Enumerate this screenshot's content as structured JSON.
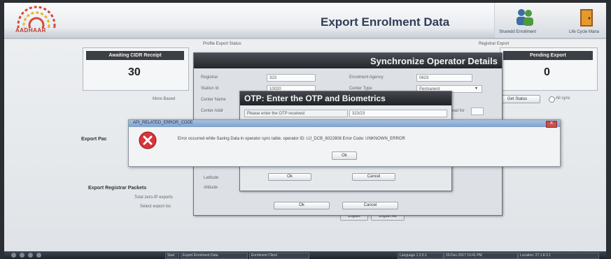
{
  "header": {
    "logo_text": "AADHAAR",
    "title": "Export Enrolment Data",
    "link_left": "Sharedd Enrollment",
    "link_right": "Life Cycle Mana"
  },
  "left_panel": {
    "legend": "Profile Export Status",
    "label": "Awaiting CIDR Receipt",
    "value": "30",
    "more_label": "More Based",
    "export_label": "Export Pac",
    "registrar_label": "Export Registrar Packets",
    "total_label": "Total zero-IP exports",
    "select_label": "Select export loc"
  },
  "right_panel": {
    "legend": "Registrar Export",
    "label": "Pending Export",
    "value": "0",
    "status_button": "Get Status",
    "all_sync_label": "All sync",
    "export_button": "Export",
    "export_all_button": "Export All"
  },
  "sync_dialog": {
    "title": "Synchronize Operator Details",
    "registrar_label": "Registrar",
    "registrar_value": "323",
    "enrolment_agency_label": "Enrolment Agency",
    "enrolment_agency_value": "0623",
    "station_id_label": "Station Id",
    "station_id_value": "10020",
    "center_type_label": "Center Type",
    "center_type_value": "Permanent",
    "center_name_label": "Center Name",
    "center_address_label": "Center Addr",
    "read_label": "read for",
    "latitude_label": "Latitude",
    "altitude_label": "Altitude",
    "ok_button": "Ok",
    "cancel_button": "Cancel"
  },
  "otp_dialog": {
    "title": "OTP: Enter the OTP and Biometrics",
    "prompt": "Please enter the OTP received",
    "otp_value": "323/23",
    "ok_button": "Ok",
    "cancel_button": "Cancel"
  },
  "error_dialog": {
    "title": "API_RELATED_ERROR_CODE",
    "message": "Error occurred while Saving Data in operator sync table. operator ID: UJ_DCB_8022808 Error Code: UNKNOWN_ERROR",
    "ok_button": "Ok",
    "close_label": "X"
  },
  "taskbar": {
    "items": [
      "Start",
      "Export Enrolment Data",
      "Enrolment Client",
      "Language 1.3.5.1",
      "20-Dec-2017 10:41 PM",
      "Location: 27.1.8.3.1"
    ]
  }
}
